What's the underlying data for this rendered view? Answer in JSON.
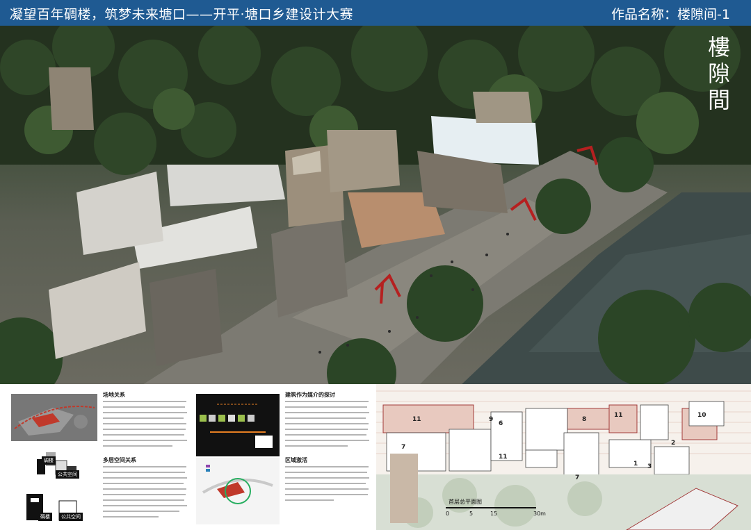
{
  "header": {
    "title": "凝望百年碉楼，筑梦未来塘口——开平·塘口乡建设计大赛",
    "work_name": "作品名称：楼隙间-1"
  },
  "hero": {
    "vertical_title": "樓隙間",
    "poem_columns": [
      "",
      "",
      "",
      "",
      "",
      "",
      ""
    ]
  },
  "sections": {
    "location": {
      "title": "场地关系"
    },
    "space": {
      "title": "多层空间关系"
    },
    "bridge": {
      "title": "建筑作为媒介的探讨"
    },
    "community": {
      "title": "区域激活"
    }
  },
  "diagram_labels": {
    "tower": "碉楼",
    "public1": "公共空间",
    "public2": "公共空间"
  },
  "plan": {
    "title": "首层总平面图",
    "scale_ticks": [
      "0",
      "5",
      "15",
      "30m"
    ],
    "room_numbers": [
      "11",
      "9",
      "6",
      "8",
      "11",
      "10",
      "2",
      "7",
      "11",
      "7",
      "1",
      "3"
    ]
  },
  "colors": {
    "header_bg": "#1f5a92",
    "accent_red": "#c0392b"
  }
}
